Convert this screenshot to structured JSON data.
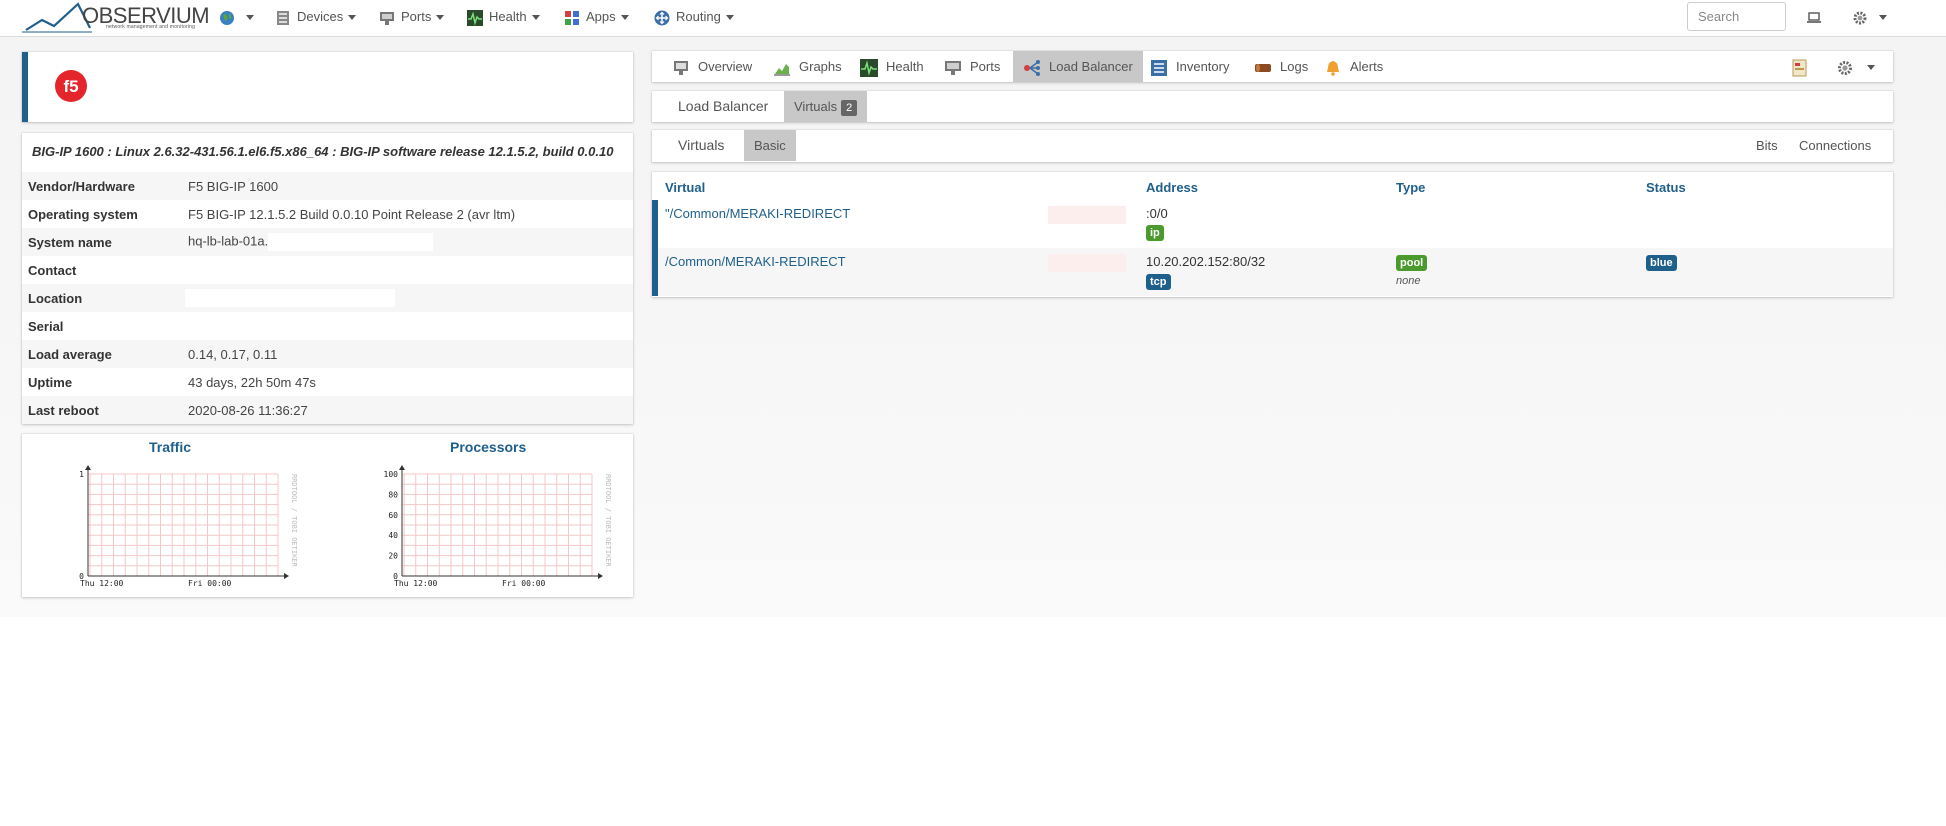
{
  "brand": {
    "name": "OBSERVIUM",
    "tagline": "network management and monitoring"
  },
  "nav": {
    "items": [
      {
        "label": "Devices"
      },
      {
        "label": "Ports"
      },
      {
        "label": "Health"
      },
      {
        "label": "Apps"
      },
      {
        "label": "Routing"
      }
    ],
    "search_placeholder": "Search"
  },
  "device": {
    "hardware_line": "BIG-IP 1600 : Linux 2.6.32-431.56.1.el6.f5.x86_64 : BIG-IP software release 12.1.5.2, build 0.0.10",
    "logo_text": "f5",
    "rows": [
      {
        "key": "Vendor/Hardware",
        "value": "F5 BIG-IP 1600"
      },
      {
        "key": "Operating system",
        "value": "F5 BIG-IP 12.1.5.2 Build 0.0.10 Point Release 2 (avr ltm)"
      },
      {
        "key": "System name",
        "value": "hq-lb-lab-01a."
      },
      {
        "key": "Contact",
        "value": ""
      },
      {
        "key": "Location",
        "value": ""
      },
      {
        "key": "Serial",
        "value": ""
      },
      {
        "key": "Load average",
        "value": "0.14, 0.17, 0.11"
      },
      {
        "key": "Uptime",
        "value": "43 days, 22h 50m 47s"
      },
      {
        "key": "Last reboot",
        "value": "2020-08-26 11:36:27"
      }
    ]
  },
  "graphs": {
    "traffic": {
      "title": "Traffic",
      "y_ticks": [
        "1",
        "0"
      ],
      "x_ticks": [
        "Thu 12:00",
        "Fri 00:00"
      ],
      "watermark": "RRDTOOL / TOBI OETIKER"
    },
    "processors": {
      "title": "Processors",
      "y_ticks": [
        "100",
        "80",
        "60",
        "40",
        "20",
        "0"
      ],
      "x_ticks": [
        "Thu 12:00",
        "Fri 00:00"
      ],
      "watermark": "RRDTOOL / TOBI OETIKER"
    }
  },
  "tabs": [
    {
      "label": "Overview"
    },
    {
      "label": "Graphs"
    },
    {
      "label": "Health"
    },
    {
      "label": "Ports"
    },
    {
      "label": "Load Balancer",
      "active": true
    },
    {
      "label": "Inventory"
    },
    {
      "label": "Logs"
    },
    {
      "label": "Alerts"
    }
  ],
  "lb_nav": {
    "title": "Load Balancer",
    "virtuals_label": "Virtuals",
    "virtuals_count": "2"
  },
  "virtuals_nav": {
    "title": "Virtuals",
    "basic": "Basic",
    "bits": "Bits",
    "connections": "Connections"
  },
  "table": {
    "headers": {
      "virtual": "Virtual",
      "address": "Address",
      "type": "Type",
      "status": "Status"
    },
    "rows": [
      {
        "virtual": "\"/Common/MERAKI-REDIRECT",
        "address": ":0/0",
        "proto": "ip",
        "type": "",
        "type_sub": "",
        "status": ""
      },
      {
        "virtual": "/Common/MERAKI-REDIRECT",
        "address": "10.20.202.152:80/32",
        "proto": "tcp",
        "type": "pool",
        "type_sub": "none",
        "status": "blue"
      }
    ]
  },
  "colors": {
    "accent": "#1f5f8b",
    "label_green": "#4a9a2d",
    "active_tab": "#c8c8c8"
  }
}
